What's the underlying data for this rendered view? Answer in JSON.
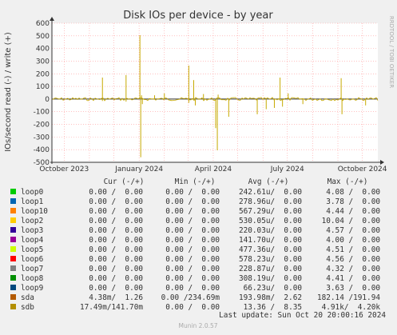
{
  "chart_data": {
    "type": "line",
    "title": "Disk IOs per device - by year",
    "ylabel": "IOs/second read (-) / write (+)",
    "side_text": "RRDTOOL / TOBI OETIKER",
    "ylim": [
      -500,
      600
    ],
    "yticks": [
      600,
      500,
      400,
      300,
      200,
      100,
      0,
      -100,
      -200,
      -300,
      -400,
      -500
    ],
    "x_ticks": [
      "October 2023",
      "January 2024",
      "April 2024",
      "July 2024",
      "October 2024"
    ],
    "x_range": [
      "2023-09-16",
      "2024-10-20"
    ],
    "series_line_color": "#c6a900",
    "spikes": [
      {
        "x": "2023-11-17",
        "y": 170
      },
      {
        "x": "2023-11-17",
        "y": -15
      },
      {
        "x": "2023-12-16",
        "y": 190
      },
      {
        "x": "2023-12-16",
        "y": -20
      },
      {
        "x": "2024-01-02",
        "y": 505
      },
      {
        "x": "2024-01-03",
        "y": -460
      },
      {
        "x": "2024-01-04",
        "y": 30
      },
      {
        "x": "2024-01-05",
        "y": -40
      },
      {
        "x": "2024-01-20",
        "y": 30
      },
      {
        "x": "2024-02-01",
        "y": 45
      },
      {
        "x": "2024-03-02",
        "y": 265
      },
      {
        "x": "2024-03-02",
        "y": -30
      },
      {
        "x": "2024-03-08",
        "y": 150
      },
      {
        "x": "2024-03-10",
        "y": -50
      },
      {
        "x": "2024-03-20",
        "y": 40
      },
      {
        "x": "2024-04-04",
        "y": -230
      },
      {
        "x": "2024-04-06",
        "y": -405
      },
      {
        "x": "2024-04-07",
        "y": 35
      },
      {
        "x": "2024-04-20",
        "y": -140
      },
      {
        "x": "2024-05-25",
        "y": -120
      },
      {
        "x": "2024-06-05",
        "y": -80
      },
      {
        "x": "2024-06-15",
        "y": -70
      },
      {
        "x": "2024-06-22",
        "y": 170
      },
      {
        "x": "2024-06-25",
        "y": -60
      },
      {
        "x": "2024-07-02",
        "y": 45
      },
      {
        "x": "2024-07-20",
        "y": -40
      },
      {
        "x": "2024-09-05",
        "y": 165
      },
      {
        "x": "2024-09-06",
        "y": -120
      },
      {
        "x": "2024-10-05",
        "y": -50
      }
    ],
    "legend_header": [
      "Cur (-/+)",
      "Min (-/+)",
      "Avg (-/+)",
      "Max (-/+)"
    ],
    "legend": [
      {
        "name": "loop0",
        "color": "#00cc00",
        "cur": "0.00 /  0.00",
        "min": "0.00 /  0.00",
        "avg": "242.61u/  0.00",
        "max": "4.08 /  0.00"
      },
      {
        "name": "loop1",
        "color": "#0066b3",
        "cur": "0.00 /  0.00",
        "min": "0.00 /  0.00",
        "avg": "278.96u/  0.00",
        "max": "3.78 /  0.00"
      },
      {
        "name": "loop10",
        "color": "#ff8000",
        "cur": "0.00 /  0.00",
        "min": "0.00 /  0.00",
        "avg": "567.29u/  0.00",
        "max": "4.44 /  0.00"
      },
      {
        "name": "loop2",
        "color": "#ffcc00",
        "cur": "0.00 /  0.00",
        "min": "0.00 /  0.00",
        "avg": "530.05u/  0.00",
        "max": "10.04 /  0.00"
      },
      {
        "name": "loop3",
        "color": "#330099",
        "cur": "0.00 /  0.00",
        "min": "0.00 /  0.00",
        "avg": "220.03u/  0.00",
        "max": "4.57 /  0.00"
      },
      {
        "name": "loop4",
        "color": "#990099",
        "cur": "0.00 /  0.00",
        "min": "0.00 /  0.00",
        "avg": "141.70u/  0.00",
        "max": "4.00 /  0.00"
      },
      {
        "name": "loop5",
        "color": "#ccff00",
        "cur": "0.00 /  0.00",
        "min": "0.00 /  0.00",
        "avg": "477.36u/  0.00",
        "max": "4.51 /  0.00"
      },
      {
        "name": "loop6",
        "color": "#ff0000",
        "cur": "0.00 /  0.00",
        "min": "0.00 /  0.00",
        "avg": "578.23u/  0.00",
        "max": "4.56 /  0.00"
      },
      {
        "name": "loop7",
        "color": "#808080",
        "cur": "0.00 /  0.00",
        "min": "0.00 /  0.00",
        "avg": "228.87u/  0.00",
        "max": "4.32 /  0.00"
      },
      {
        "name": "loop8",
        "color": "#008f00",
        "cur": "0.00 /  0.00",
        "min": "0.00 /  0.00",
        "avg": "308.19u/  0.00",
        "max": "4.41 /  0.00"
      },
      {
        "name": "loop9",
        "color": "#00487d",
        "cur": "0.00 /  0.00",
        "min": "0.00 /  0.00",
        "avg": "66.23u/  0.00",
        "max": "3.63 /  0.00"
      },
      {
        "name": "sda",
        "color": "#b35a00",
        "cur": "4.38m/  1.26",
        "min": "0.00 /234.69m",
        "avg": "193.98m/  2.62",
        "max": "182.14 /191.94"
      },
      {
        "name": "sdb",
        "color": "#b38f00",
        "cur": "17.49m/141.70m",
        "min": "0.00 /  0.00",
        "avg": "13.36 /  8.35",
        "max": "4.91k/  4.20k"
      }
    ],
    "last_update": "Last update: Sun Oct 20 20:00:16 2024",
    "footer": "Munin 2.0.57"
  }
}
